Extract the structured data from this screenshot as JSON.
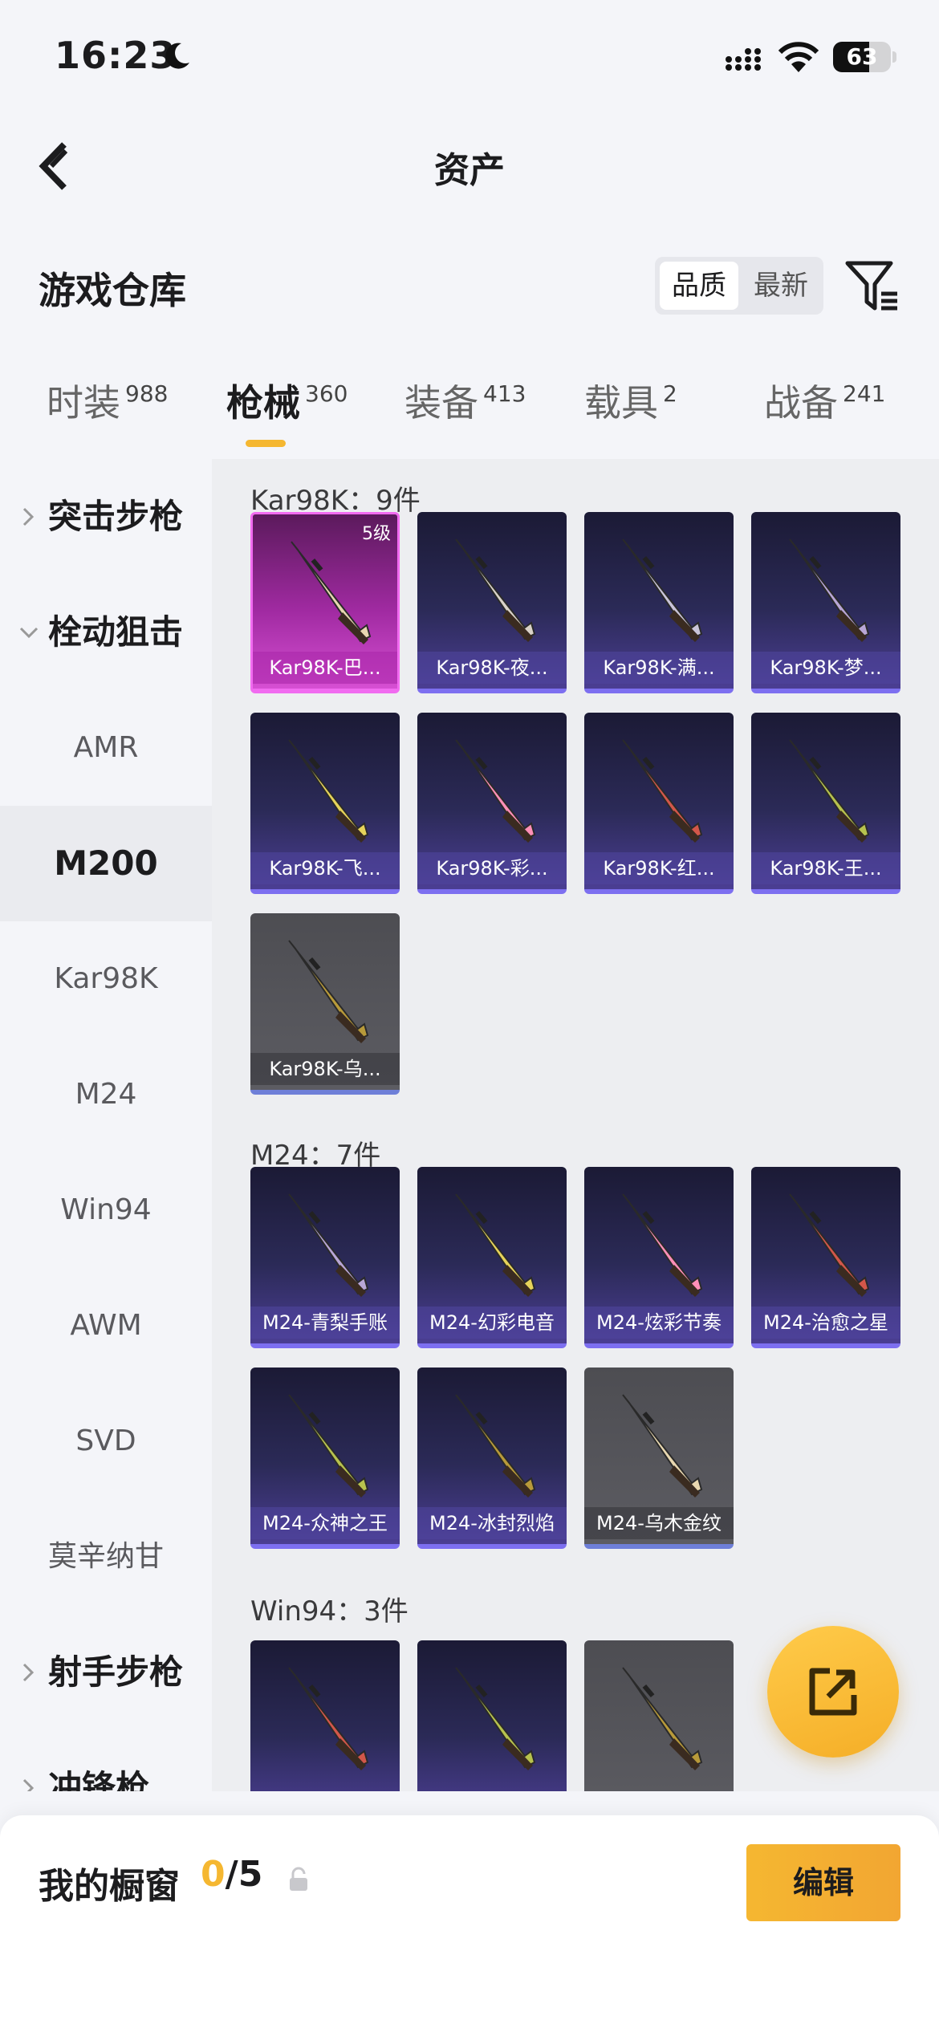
{
  "status_bar": {
    "time": "16:23",
    "battery": "63",
    "battery_level": 0.63
  },
  "nav": {
    "title": "资产"
  },
  "warehouse": {
    "title": "游戏仓库",
    "sort_options": [
      "品质",
      "最新"
    ],
    "selected_sort": "品质"
  },
  "tabs": [
    {
      "label": "时装",
      "count": "988"
    },
    {
      "label": "枪械",
      "count": "360"
    },
    {
      "label": "装备",
      "count": "413"
    },
    {
      "label": "载具",
      "count": "2"
    },
    {
      "label": "战备",
      "count": "241"
    }
  ],
  "active_tab": "枪械",
  "sidebar": {
    "items": [
      {
        "label": "突击步枪",
        "type": "group",
        "expanded": false
      },
      {
        "label": "栓动狙击",
        "type": "group",
        "expanded": true
      },
      {
        "label": "AMR",
        "type": "sub"
      },
      {
        "label": "M200",
        "type": "sub",
        "selected": true
      },
      {
        "label": "Kar98K",
        "type": "sub"
      },
      {
        "label": "M24",
        "type": "sub"
      },
      {
        "label": "Win94",
        "type": "sub"
      },
      {
        "label": "AWM",
        "type": "sub"
      },
      {
        "label": "SVD",
        "type": "sub"
      },
      {
        "label": "莫辛纳甘",
        "type": "sub"
      },
      {
        "label": "射手步枪",
        "type": "group",
        "expanded": false
      },
      {
        "label": "冲锋枪",
        "type": "group",
        "expanded": false
      }
    ]
  },
  "sections": [
    {
      "title": "Kar98K：9件",
      "items": [
        {
          "name": "Kar98K-巴...",
          "level": "5级",
          "rarity": "pink"
        },
        {
          "name": "Kar98K-夜...",
          "rarity": "purple"
        },
        {
          "name": "Kar98K-满...",
          "rarity": "purple"
        },
        {
          "name": "Kar98K-梦...",
          "rarity": "purple"
        },
        {
          "name": "Kar98K-飞...",
          "rarity": "purple"
        },
        {
          "name": "Kar98K-彩...",
          "rarity": "purple"
        },
        {
          "name": "Kar98K-红...",
          "rarity": "purple"
        },
        {
          "name": "Kar98K-王...",
          "rarity": "purple"
        },
        {
          "name": "Kar98K-乌...",
          "rarity": "gray"
        }
      ]
    },
    {
      "title": "M24：7件",
      "items": [
        {
          "name": "M24-青梨手账",
          "rarity": "purple"
        },
        {
          "name": "M24-幻彩电音",
          "rarity": "purple"
        },
        {
          "name": "M24-炫彩节奏",
          "rarity": "purple"
        },
        {
          "name": "M24-治愈之星",
          "rarity": "purple"
        },
        {
          "name": "M24-众神之王",
          "rarity": "purple"
        },
        {
          "name": "M24-冰封烈焰",
          "rarity": "purple"
        },
        {
          "name": "M24-乌木金纹",
          "rarity": "gray"
        }
      ]
    },
    {
      "title": "Win94：3件",
      "items": [
        {
          "name": "",
          "rarity": "purple"
        },
        {
          "name": "",
          "rarity": "purple"
        },
        {
          "name": "",
          "rarity": "gray"
        }
      ]
    }
  ],
  "showcase": {
    "label": "我的橱窗",
    "current": "0",
    "total": "/5",
    "edit_label": "编辑"
  },
  "colors": {
    "accent": "#f5b731",
    "purple_card": "#4b3e93",
    "pink_card": "#d64fd3",
    "gray_card": "#5c5c62"
  }
}
